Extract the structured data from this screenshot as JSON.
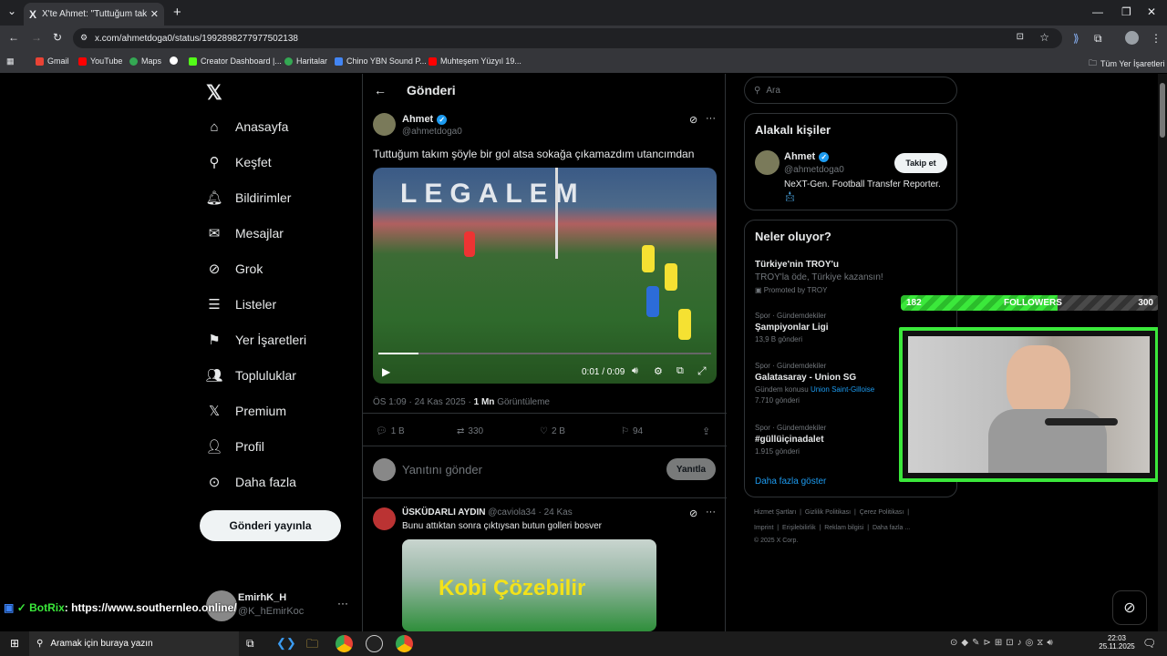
{
  "browser": {
    "tab_title": "X'te Ahmet: \"Tuttuğum takım ş",
    "url": "x.com/ahmetdoga0/status/1992898277977502138",
    "bookmarks": [
      "Gmail",
      "YouTube",
      "Maps",
      "Creator Dashboard |...",
      "Haritalar",
      "Chino YBN Sound P...",
      "Muhteşem Yüzyıl 19..."
    ],
    "all_bookmarks": "Tüm Yer İşaretleri"
  },
  "nav": {
    "items": [
      "Anasayfa",
      "Keşfet",
      "Bildirimler",
      "Mesajlar",
      "Grok",
      "Listeler",
      "Yer İşaretleri",
      "Topluluklar",
      "Premium",
      "Profil",
      "Daha fazla"
    ],
    "post_button": "Gönderi yayınla",
    "account_name": "EmirhK_H",
    "account_handle": "@K_hEmirKoc"
  },
  "main": {
    "header": "Gönderi",
    "author_name": "Ahmet",
    "author_handle": "@ahmetdoga0",
    "text": "Tuttuğum takım şöyle bir gol atsa sokağa çıkamazdım utancımdan",
    "video_time": "0:01 / 0:09",
    "video_banner": "LEGALEM",
    "meta_time": "ÖS 1:09 · 24 Kas 2025 ·",
    "views_count": "1 Mn",
    "views_label": "Görüntüleme",
    "replies": "1 B",
    "retweets": "330",
    "likes": "2 B",
    "bookmarks": "94",
    "reply_placeholder": "Yanıtını gönder",
    "reply_button": "Yanıtla",
    "reply_author": "ÜSKÜDARLI AYDIN",
    "reply_handle": "@caviola34 · 24 Kas",
    "reply_text": "Bunu attıktan sonra çıktıysan butun golleri bosver",
    "reply_image_text": "Kobi Çözebilir"
  },
  "right": {
    "search_placeholder": "Ara",
    "related_title": "Alakalı kişiler",
    "rel_name": "Ahmet",
    "rel_handle": "@ahmetdoga0",
    "follow_button": "Takip et",
    "rel_bio": "NeXT-Gen. Football Transfer Reporter.",
    "trends_title": "Neler oluyor?",
    "trends": [
      {
        "top": "Türkiye'nin TROY'u",
        "mid": "TROY'la öde, Türkiye kazansın!",
        "bot": "Promoted by TROY"
      },
      {
        "top": "Spor · Gündemdekiler",
        "mid": "Şampiyonlar Ligi",
        "bot": "13,9 B gönderi"
      },
      {
        "top": "Spor · Gündemdekiler",
        "mid": "Galatasaray - Union SG",
        "bot2a": "Gündem konusu",
        "bot2b": "Union Saint-Gilloise",
        "bot": "7.710 gönderi"
      },
      {
        "top": "Spor · Gündemdekiler",
        "mid": "#güllüiçinadalet",
        "bot": "1.915 gönderi"
      }
    ],
    "show_more": "Daha fazla göster",
    "footer1": [
      "Hizmet Şartları",
      "Gizlilik Politikası",
      "Çerez Politikası"
    ],
    "footer2": [
      "Imprint",
      "Erişilebilirlik",
      "Reklam bilgisi",
      "Daha fazla ..."
    ],
    "copyright": "© 2025 X Corp."
  },
  "stream": {
    "followers_current": "182",
    "followers_label": "FOLLOWERS",
    "followers_goal": "300",
    "followers_progress": 0.607,
    "chat_user": "BotRix",
    "chat_text": ": https://www.southernleo.online/"
  },
  "taskbar": {
    "search": "Aramak için buraya yazın",
    "time": "22:03",
    "date": "25.11.2025"
  },
  "colors": {
    "accent": "#1d9bf0",
    "green": "#3be83b"
  }
}
